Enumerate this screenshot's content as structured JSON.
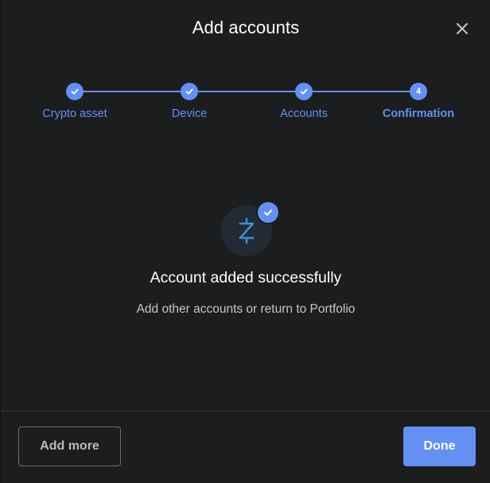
{
  "header": {
    "title": "Add accounts",
    "close_icon": "close-icon"
  },
  "stepper": {
    "steps": [
      {
        "label": "Crypto asset",
        "state": "done",
        "icon": "check-icon"
      },
      {
        "label": "Device",
        "state": "done",
        "icon": "check-icon"
      },
      {
        "label": "Accounts",
        "state": "done",
        "icon": "check-icon"
      },
      {
        "label": "Confirmation",
        "state": "active",
        "number": "4"
      }
    ],
    "accent_color": "#6490f1"
  },
  "success": {
    "asset_icon": "zcash-icon",
    "badge_icon": "check-icon",
    "title": "Account added successfully",
    "subtitle": "Add other accounts or return to Portfolio"
  },
  "footer": {
    "add_more_label": "Add more",
    "done_label": "Done"
  }
}
